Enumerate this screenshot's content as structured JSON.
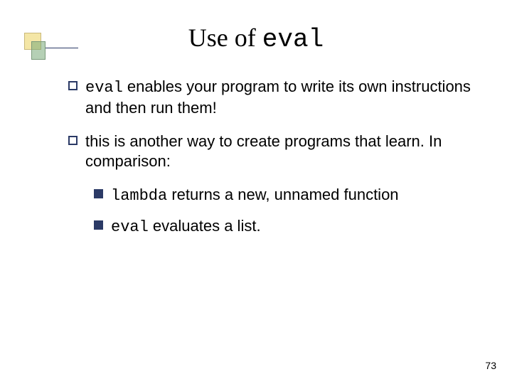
{
  "title": {
    "pre": "Use of ",
    "code": "eval"
  },
  "bullets": [
    {
      "level": 1,
      "parts": [
        {
          "kind": "code",
          "text": "eval"
        },
        {
          "kind": "text",
          "text": " enables your program to write its own instructions and then run them!"
        }
      ]
    },
    {
      "level": 1,
      "parts": [
        {
          "kind": "text",
          "text": "this is another way to create programs that learn.  In comparison:"
        }
      ]
    },
    {
      "level": 2,
      "parts": [
        {
          "kind": "code",
          "text": "lambda"
        },
        {
          "kind": "text",
          "text": " returns a new, unnamed function"
        }
      ]
    },
    {
      "level": 2,
      "parts": [
        {
          "kind": "code",
          "text": "eval"
        },
        {
          "kind": "text",
          "text": " evaluates a list."
        }
      ]
    }
  ],
  "page_number": "73"
}
